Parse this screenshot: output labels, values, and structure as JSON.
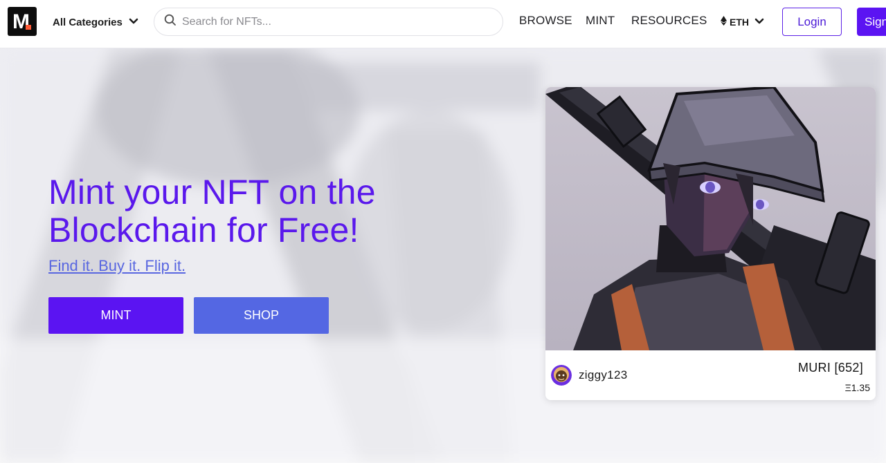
{
  "header": {
    "logo_letter": "M",
    "category_select": {
      "value": "All Categories"
    },
    "search": {
      "placeholder": "Search for NFTs..."
    },
    "nav": {
      "browse": "BROWSE",
      "mint": "MINT",
      "resources": "RESOURCES"
    },
    "currency_select": {
      "value": "ETH"
    },
    "login_label": "Login",
    "signup_label": "Sign"
  },
  "hero": {
    "headline": "Mint your NFT on the Blockchain for Free!",
    "tagline": "Find it. Buy it. Flip it.",
    "mint_button": "MINT",
    "shop_button": "SHOP"
  },
  "featured_nft": {
    "owner": "ziggy123",
    "name": "MURI [652]",
    "price": "Ξ1.35"
  },
  "colors": {
    "brand_purple": "#5b14f2",
    "shop_blue": "#5467e3",
    "headline_purple": "#5a18ec",
    "link_blue": "#5866e0",
    "logo_accent": "#ff5a36"
  },
  "icons": {
    "search": "search-icon",
    "chevron": "chevron-down-icon",
    "eth": "ethereum-icon"
  }
}
